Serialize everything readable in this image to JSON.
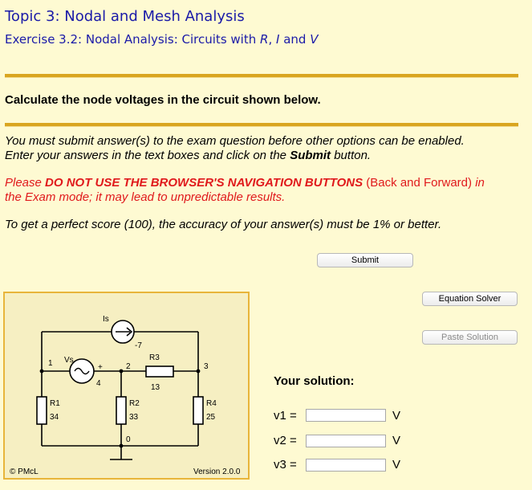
{
  "header": {
    "topic": "Topic 3: Nodal and Mesh Analysis",
    "exercise_prefix": "Exercise 3.2: Nodal Analysis: Circuits with ",
    "exercise_r": "R",
    "exercise_comma": ", ",
    "exercise_i": "I",
    "exercise_and": " and ",
    "exercise_v": "V"
  },
  "question": "Calculate the node voltages in the circuit shown below.",
  "instructions": {
    "line1": "You must submit answer(s) to the exam question before other options can be enabled.",
    "line2_pre": "Enter your answers in the text boxes and click on the ",
    "line2_bold": "Submit",
    "line2_post": " button.",
    "warn_pre": "Please ",
    "warn_bold": "DO NOT USE THE BROWSER'S NAVIGATION BUTTONS",
    "warn_mid": " (Back and Forward) ",
    "warn_line1_end": "in",
    "warn_line2": "the Exam mode; it may lead to unpredictable results.",
    "score": "To get a perfect score (100), the accuracy of your answer(s) must be 1% or better."
  },
  "buttons": {
    "submit": "Submit",
    "equation_solver": "Equation Solver",
    "paste_solution": "Paste Solution"
  },
  "circuit": {
    "labels": {
      "is": "Is",
      "is_value": "-7",
      "vs": "Vs",
      "plus": "+",
      "r3": "R3",
      "r3_value": "13",
      "r1": "R1",
      "r1_value": "34",
      "r2": "R2",
      "r2_value": "33",
      "r4": "R4",
      "r4_value": "25",
      "node1": "1",
      "node2": "2",
      "node3": "3",
      "node4": "4",
      "node0": "0"
    },
    "copyright": "© PMcL",
    "version": "Version 2.0.0"
  },
  "solution": {
    "heading": "Your solution:",
    "answers": [
      {
        "label": "v1 =",
        "value": "",
        "unit": "V"
      },
      {
        "label": "v2 =",
        "value": "",
        "unit": "V"
      },
      {
        "label": "v3 =",
        "value": "",
        "unit": "V"
      }
    ]
  }
}
